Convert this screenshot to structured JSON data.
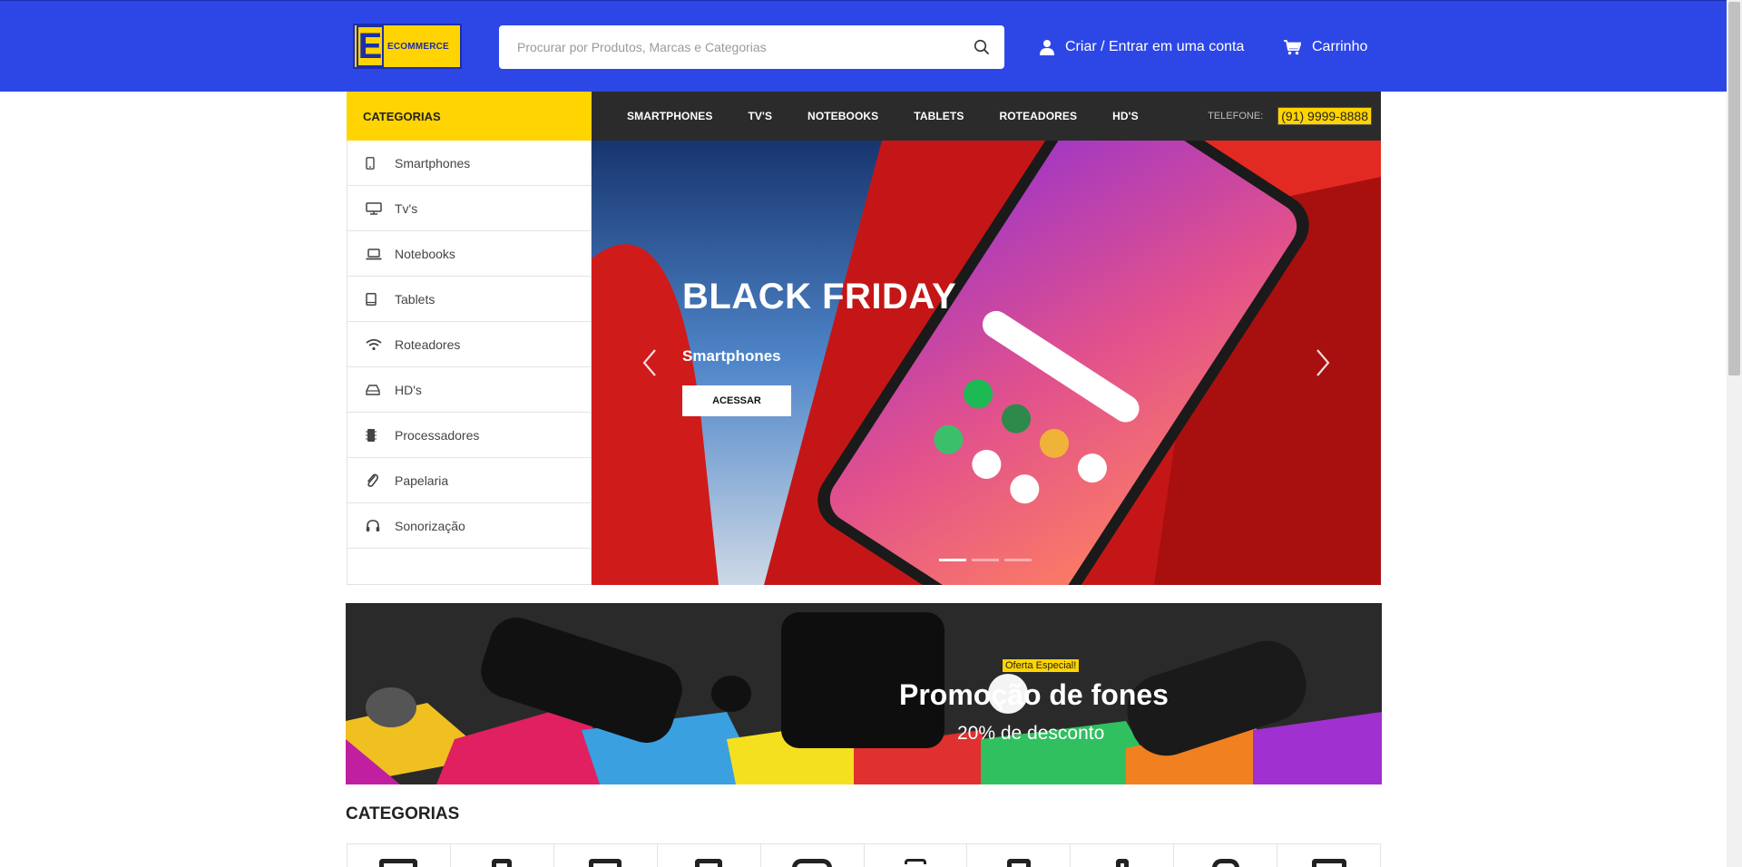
{
  "header": {
    "logo_text": "ECOMMERCE",
    "logo_letter": "E",
    "search_placeholder": "Procurar por Produtos, Marcas e Categorias",
    "account_label": "Criar / Entrar em uma conta",
    "cart_label": "Carrinho"
  },
  "sidebar": {
    "title": "CATEGORIAS",
    "items": [
      {
        "label": "Smartphones",
        "icon": "smartphone-icon"
      },
      {
        "label": "Tv's",
        "icon": "monitor-icon"
      },
      {
        "label": "Notebooks",
        "icon": "laptop-icon"
      },
      {
        "label": "Tablets",
        "icon": "tablet-icon"
      },
      {
        "label": "Roteadores",
        "icon": "wifi-icon"
      },
      {
        "label": "HD's",
        "icon": "hard-drive-icon"
      },
      {
        "label": "Processadores",
        "icon": "cpu-icon"
      },
      {
        "label": "Papelaria",
        "icon": "paperclip-icon"
      },
      {
        "label": "Sonorização",
        "icon": "headphones-icon"
      }
    ]
  },
  "nav": {
    "items": [
      "SMARTPHONES",
      "TV'S",
      "NOTEBOOKS",
      "TABLETS",
      "ROTEADORES",
      "HD'S"
    ],
    "phone_label": "TELEFONE:",
    "phone_number": "(91) 9999-8888"
  },
  "hero": {
    "title": "BLACK FRIDAY",
    "subtitle": "Smartphones",
    "button_label": "ACESSAR",
    "slides_total": 3,
    "active_slide": 1
  },
  "promo": {
    "badge": "Oferta Especial!",
    "title": "Promoção de fones",
    "subtitle": "20% de desconto"
  },
  "categories_section": {
    "title": "CATEGORIAS",
    "card_count": 10
  },
  "colors": {
    "header_blue": "#2d47e6",
    "accent_yellow": "#ffd400",
    "nav_dark": "#2b2b2b"
  }
}
